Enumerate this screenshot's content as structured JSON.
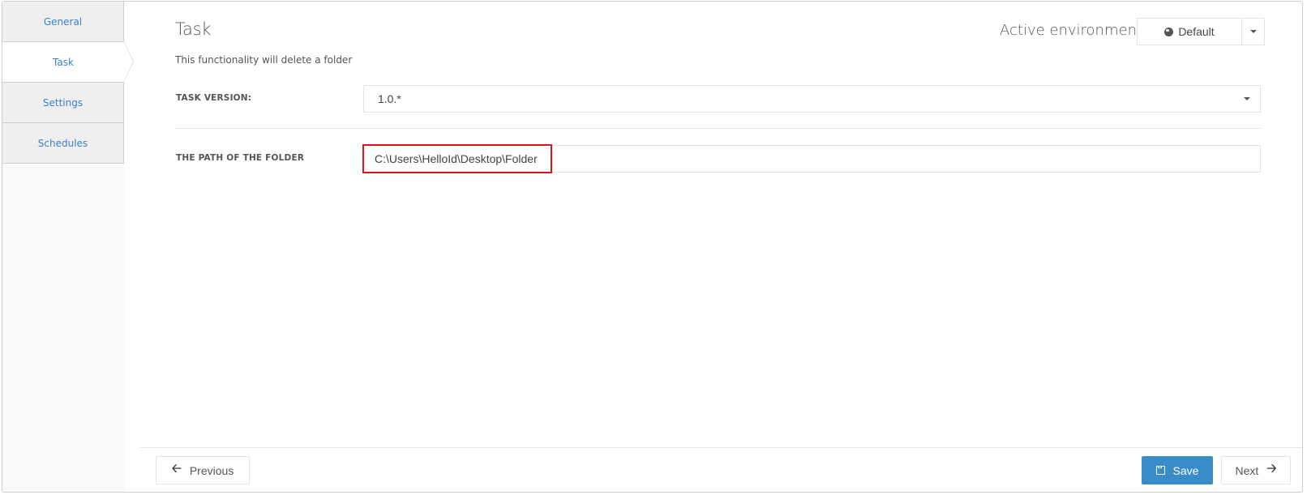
{
  "sidebar": {
    "items": [
      {
        "label": "General",
        "active": false
      },
      {
        "label": "Task",
        "active": true
      },
      {
        "label": "Settings",
        "active": false
      },
      {
        "label": "Schedules",
        "active": false
      }
    ]
  },
  "header": {
    "title": "Task",
    "subtitle": "This functionality will delete a folder",
    "environment_label": "Active environment",
    "environment_value": "Default",
    "environment_icon": "globe-icon"
  },
  "form": {
    "task_version_label": "TASK VERSION:",
    "task_version_value": "1.0.*",
    "folder_path_label": "THE PATH OF THE FOLDER",
    "folder_path_value": "C:\\Users\\HelloId\\Desktop\\Folder",
    "highlight_color": "#e0121b"
  },
  "footer": {
    "previous_label": "Previous",
    "save_label": "Save",
    "next_label": "Next",
    "save_color": "#3a8cc9"
  }
}
